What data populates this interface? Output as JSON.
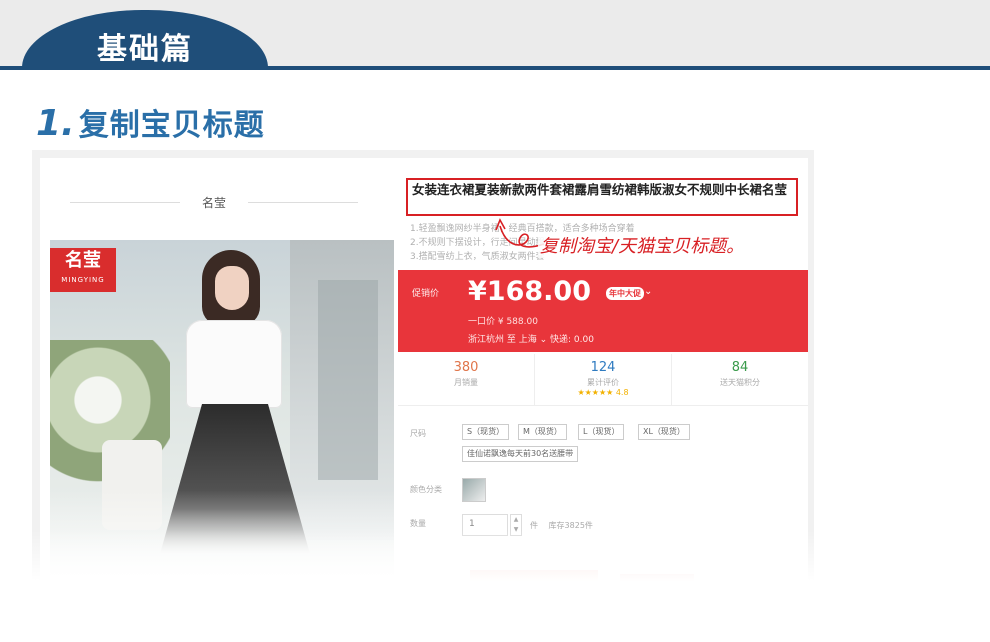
{
  "header": {
    "tab_label": "基础篇"
  },
  "step": {
    "number": "1.",
    "title": "复制宝贝标题"
  },
  "shop": {
    "brand_name": "名莹",
    "logo_cn": "名莹",
    "logo_en": "MINGYING"
  },
  "product": {
    "title": "女装连衣裙夏装新款两件套裙露肩雪纺裙韩版淑女不规则中长裙名莹",
    "desc_lines": [
      "1.轻盈飘逸网纱半身裙，经典百搭款，适合多种场合穿着",
      "2.不规则下摆设计，行走间灵动飘逸",
      "3.搭配雪纺上衣，气质淑女两件套"
    ],
    "annotation": "复制淘宝/天猫宝贝标题。"
  },
  "price": {
    "label": "促销价",
    "value": "¥168.00",
    "badge": "年中大促",
    "chevron": "⌄",
    "original": "一口价 ¥ 588.00",
    "shipping": "浙江杭州 至 上海 ⌄  快递: 0.00"
  },
  "stats": [
    {
      "num": "380",
      "label": "月销量"
    },
    {
      "num": "124",
      "label": "累计评价",
      "stars": "★★★★★ 4.8"
    },
    {
      "num": "84",
      "label": "送天猫积分"
    }
  ],
  "options": {
    "size_label": "尺码",
    "sizes": [
      "S（现货）",
      "M（现货）",
      "L（现货）",
      "XL（现货）"
    ],
    "promo": "佳仙诺飘逸每天前30名送腰带",
    "color_label": "颜色分类",
    "qty_label": "数量",
    "qty_value": "1",
    "unit": "件",
    "stock": "库存3825件"
  }
}
